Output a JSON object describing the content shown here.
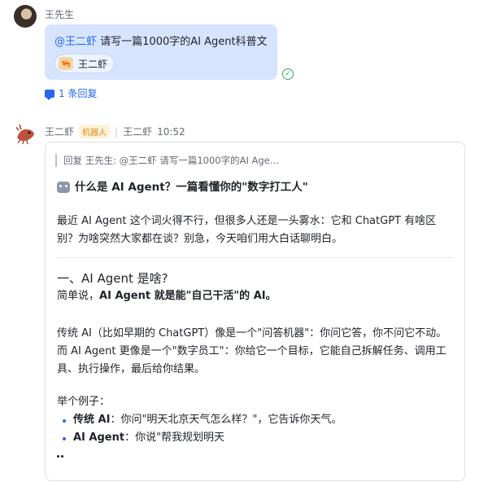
{
  "user_message": {
    "sender": "王先生",
    "mention": "@王二虾",
    "text": "请写一篇1000字的AI Agent科普文",
    "chip_label": "王二虾",
    "reply_link": "1 条回复"
  },
  "bot_message": {
    "sender": "王二虾",
    "badge": "机器人",
    "meta_name": "王二虾",
    "time": "10:52",
    "quote": "回复 王先生: @王二虾 请写一篇1000字的AI Age...",
    "title": "什么是 AI Agent？一篇看懂你的\"数字打工人\"",
    "intro": "最近 AI Agent 这个词火得不行，但很多人还是一头雾水：它和 ChatGPT 有啥区别？为啥突然大家都在谈？别急，今天咱们用大白话聊明白。",
    "section_heading": "一、AI Agent 是啥?",
    "simple_prefix": "简单说，",
    "simple_bold": "AI Agent 就是能\"自己干活\"的 AI。",
    "compare_text": "传统 AI（比如早期的 ChatGPT）像是一个\"问答机器\"：你问它答，你不问它不动。而 AI Agent 更像是一个\"数字员工\"：你给它一个目标，它能自己拆解任务、调用工具、执行操作，最后给你结果。",
    "example_label": "举个例子：",
    "examples": [
      {
        "term": "传统 AI",
        "text": "：你问\"明天北京天气怎么样？\"，它告诉你天气。"
      },
      {
        "term": "AI Agent",
        "text": "：你说\"帮我规划明天"
      }
    ]
  },
  "colors": {
    "accent": "#2468f2",
    "bubble": "#d6e4ff",
    "read_check": "#34a853",
    "bot_badge": "#d98d16"
  },
  "icons": [
    "user-avatar",
    "bot-avatar",
    "read-check-icon",
    "reply-icon",
    "robot-emoji-icon"
  ]
}
